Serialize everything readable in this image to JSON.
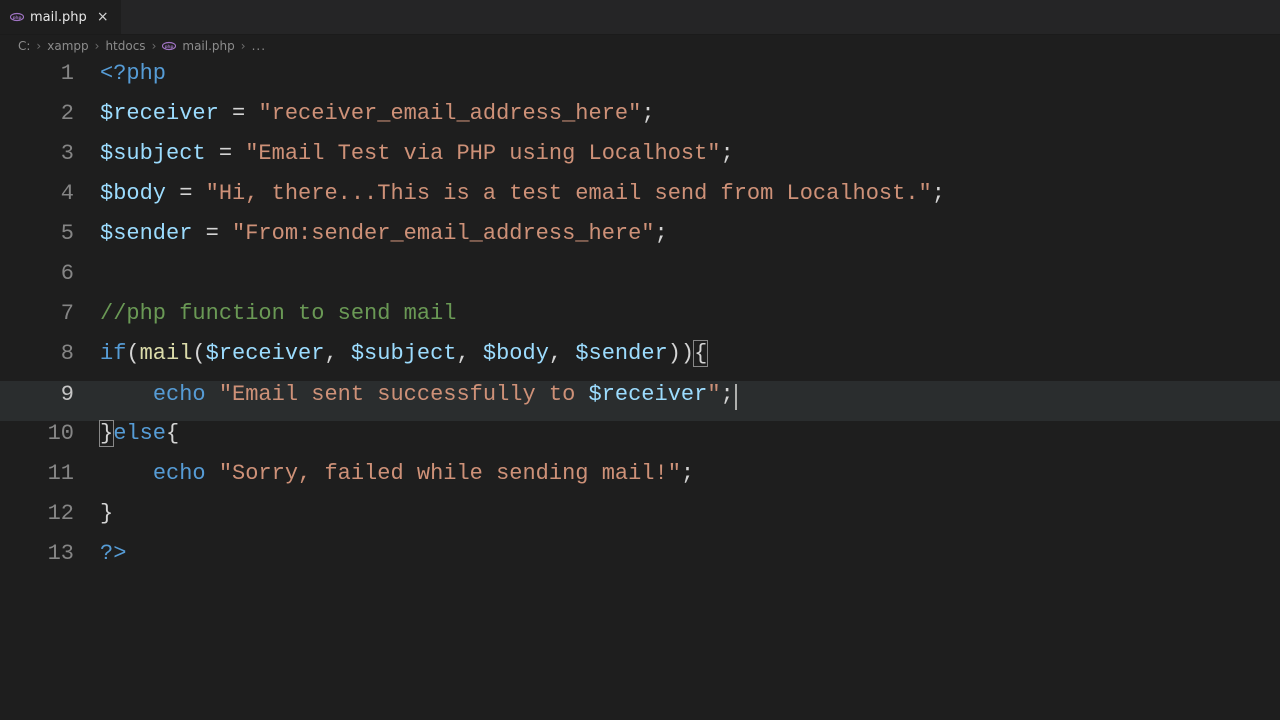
{
  "tabs": [
    {
      "label": "mail.php",
      "icon": "php-icon"
    }
  ],
  "breadcrumb": {
    "parts": [
      "C:",
      "xampp",
      "htdocs"
    ],
    "file": "mail.php",
    "ellipsis": "..."
  },
  "code_lines": [
    {
      "n": "1",
      "tokens": [
        {
          "t": "<?php",
          "c": "kw"
        }
      ]
    },
    {
      "n": "2",
      "tokens": [
        {
          "t": "$receiver",
          "c": "var"
        },
        {
          "t": " = ",
          "c": "op"
        },
        {
          "t": "\"receiver_email_address_here\"",
          "c": "str"
        },
        {
          "t": ";",
          "c": "op"
        }
      ]
    },
    {
      "n": "3",
      "tokens": [
        {
          "t": "$subject",
          "c": "var"
        },
        {
          "t": " = ",
          "c": "op"
        },
        {
          "t": "\"Email Test via PHP using Localhost\"",
          "c": "str"
        },
        {
          "t": ";",
          "c": "op"
        }
      ]
    },
    {
      "n": "4",
      "tokens": [
        {
          "t": "$body",
          "c": "var"
        },
        {
          "t": " = ",
          "c": "op"
        },
        {
          "t": "\"Hi, there...This is a test email send from Localhost.\"",
          "c": "str"
        },
        {
          "t": ";",
          "c": "op"
        }
      ]
    },
    {
      "n": "5",
      "tokens": [
        {
          "t": "$sender",
          "c": "var"
        },
        {
          "t": " = ",
          "c": "op"
        },
        {
          "t": "\"From:sender_email_address_here\"",
          "c": "str"
        },
        {
          "t": ";",
          "c": "op"
        }
      ]
    },
    {
      "n": "6",
      "tokens": []
    },
    {
      "n": "7",
      "tokens": [
        {
          "t": "//php function to send mail",
          "c": "cm"
        }
      ]
    },
    {
      "n": "8",
      "tokens": [
        {
          "t": "if",
          "c": "kw"
        },
        {
          "t": "(",
          "c": "op"
        },
        {
          "t": "mail",
          "c": "fn"
        },
        {
          "t": "(",
          "c": "op"
        },
        {
          "t": "$receiver",
          "c": "var"
        },
        {
          "t": ", ",
          "c": "op"
        },
        {
          "t": "$subject",
          "c": "var"
        },
        {
          "t": ", ",
          "c": "op"
        },
        {
          "t": "$body",
          "c": "var"
        },
        {
          "t": ", ",
          "c": "op"
        },
        {
          "t": "$sender",
          "c": "var"
        },
        {
          "t": "))",
          "c": "op"
        },
        {
          "t": "{",
          "c": "op",
          "hl": true
        }
      ]
    },
    {
      "n": "9",
      "active": true,
      "tokens": [
        {
          "t": "    ",
          "c": "op"
        },
        {
          "t": "echo",
          "c": "kw"
        },
        {
          "t": " ",
          "c": "op"
        },
        {
          "t": "\"Email sent successfully to ",
          "c": "str"
        },
        {
          "t": "$receiver",
          "c": "var"
        },
        {
          "t": "\"",
          "c": "str"
        },
        {
          "t": ";",
          "c": "op",
          "cursor": true
        }
      ]
    },
    {
      "n": "10",
      "tokens": [
        {
          "t": "}",
          "c": "op",
          "hl": true
        },
        {
          "t": "else",
          "c": "kw"
        },
        {
          "t": "{",
          "c": "op"
        }
      ]
    },
    {
      "n": "11",
      "tokens": [
        {
          "t": "    ",
          "c": "op"
        },
        {
          "t": "echo",
          "c": "kw"
        },
        {
          "t": " ",
          "c": "op"
        },
        {
          "t": "\"Sorry, failed while sending mail!\"",
          "c": "str"
        },
        {
          "t": ";",
          "c": "op"
        }
      ]
    },
    {
      "n": "12",
      "tokens": [
        {
          "t": "}",
          "c": "op"
        }
      ]
    },
    {
      "n": "13",
      "tokens": [
        {
          "t": "?>",
          "c": "kw"
        }
      ]
    }
  ]
}
